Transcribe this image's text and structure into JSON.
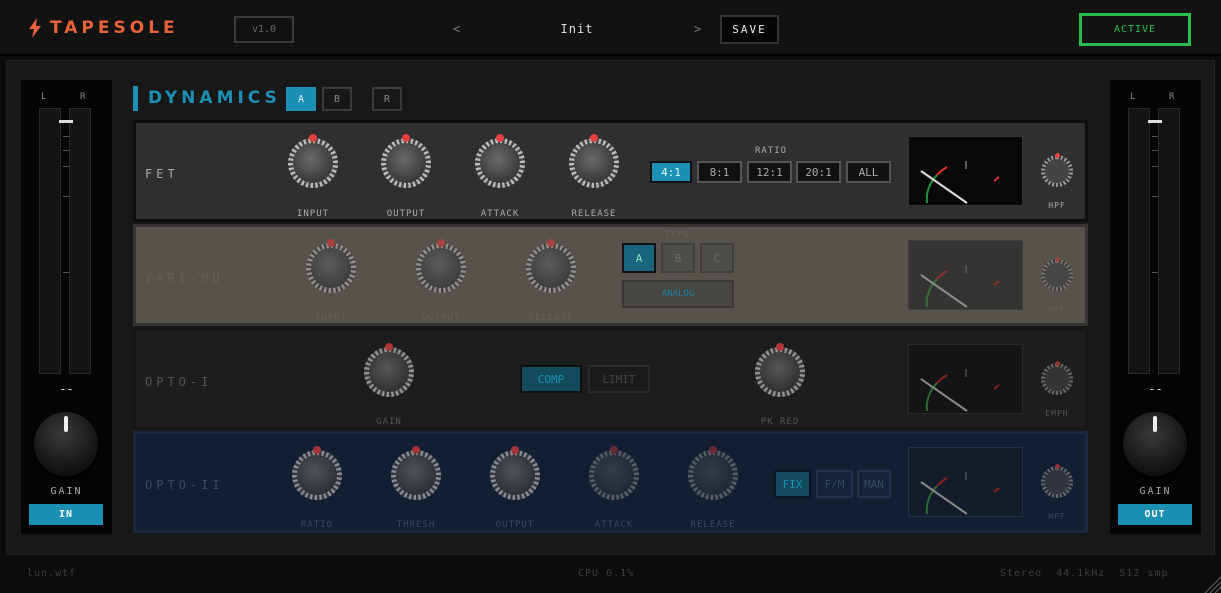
{
  "header": {
    "brand": "TAPESOLE",
    "version": "v1.0",
    "prev": "<",
    "next": ">",
    "preset": "Init",
    "save": "SAVE",
    "active": "ACTIVE"
  },
  "section": {
    "title": "DYNAMICS",
    "slots": [
      "A",
      "B",
      "R"
    ]
  },
  "input_side": {
    "l": "L",
    "r": "R",
    "readout": "--",
    "gain": "GAIN",
    "button": "IN"
  },
  "output_side": {
    "l": "L",
    "r": "R",
    "readout": "--",
    "gain": "GAIN",
    "button": "OUT"
  },
  "fet": {
    "name": "FET",
    "knobs": [
      "INPUT",
      "OUTPUT",
      "ATTACK",
      "RELEASE"
    ],
    "ratio_label": "RATIO",
    "ratios": [
      "4:1",
      "8:1",
      "12:1",
      "20:1",
      "ALL"
    ],
    "active_ratio": "4:1",
    "hpf": "HPF"
  },
  "varimu": {
    "name": "VARI-MU",
    "knobs": [
      "INPUT",
      "OUTPUT",
      "RELEASE"
    ],
    "type_label": "TYPE",
    "types": [
      "A",
      "B",
      "C"
    ],
    "analog": "ANALOG",
    "hpf": "HPF"
  },
  "opto1": {
    "name": "OPTO-I",
    "knobs": [
      "GAIN",
      "PK RED"
    ],
    "modes": [
      "COMP",
      "LIMIT"
    ],
    "emph": "EMPH"
  },
  "opto2": {
    "name": "OPTO-II",
    "knobs": [
      "RATIO",
      "THRESH",
      "OUTPUT",
      "ATTACK",
      "RELEASE"
    ],
    "modes": [
      "FIX",
      "F/M",
      "MAN"
    ],
    "hpf": "HPF"
  },
  "status": {
    "left": "lun.wtf",
    "cpu": "CPU 0.1%",
    "right": "Stereo  44.1kHz  512 smp"
  },
  "colors": {
    "accent": "#1b8fb4",
    "brand": "#e8623a",
    "active": "#2bbd4b",
    "knob_dot": "#e34040"
  }
}
